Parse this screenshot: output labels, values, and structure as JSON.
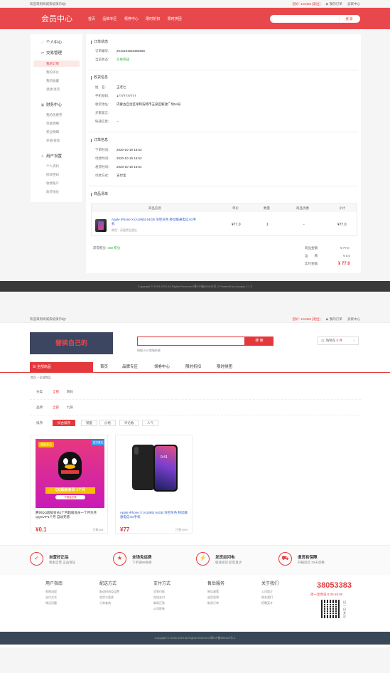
{
  "top": {
    "topbar": {
      "welcome": "欢迎来到商城系统演示站!",
      "user": "您好: 123456 [退出]",
      "my_orders": "★ 我的订单",
      "seller_center": "卖家中心"
    },
    "header": {
      "title": "会员中心",
      "nav": [
        "首页",
        "品牌专区",
        "领券中心",
        "限时折扣",
        "限时拼团"
      ],
      "search_btn": "搜 索"
    },
    "sidebar": {
      "groups": [
        {
          "label": "个人中心",
          "icon": "home-icon"
        },
        {
          "label": "交易管理",
          "icon": "exchange-icon",
          "items": [
            "我的订单",
            "我的评价",
            "我的收藏",
            "退款/退货"
          ]
        },
        {
          "label": "财务中心",
          "icon": "finance-icon",
          "items": [
            "我的优惠券",
            "资金明细",
            "积分明细",
            "充值/提现"
          ]
        },
        {
          "label": "用户设置",
          "icon": "user-icon",
          "items": [
            "个人资料",
            "修改密码",
            "收款账户",
            "收货地址"
          ]
        }
      ]
    },
    "order_status": {
      "title": "订单状态",
      "order_no_label": "订单编号:",
      "order_no": "2010191653355655",
      "status_label": "当前状态:",
      "status": "交易完成"
    },
    "receiver": {
      "title": "收货信息",
      "name_label": "姓　名:",
      "name": "王老七",
      "phone_label": "手机号码:",
      "phone": "17777777777",
      "address_label": "收货地址:",
      "address": "内蒙古自治区呼和浩特市玉泉区解放广场54号",
      "note_label": "买家留言:",
      "note": "",
      "express_label": "快递信息:",
      "express": "--"
    },
    "order_info": {
      "title": "订单信息",
      "rows": [
        {
          "label": "下单时间:",
          "value": "2020-10-19 16:53"
        },
        {
          "label": "付款时间:",
          "value": "2020-10-19 16:53"
        },
        {
          "label": "发货时间:",
          "value": "2020-10-19 16:54"
        },
        {
          "label": "付款方式:",
          "value": "支付宝"
        }
      ]
    },
    "goods": {
      "title": "商品清单",
      "headers": [
        "商品信息",
        "单价",
        "数量",
        "商品优惠",
        "小计"
      ],
      "item": {
        "name": "Apple iPhone X (A1865) 64GB 深空灰色 移动联通电信4G手机",
        "spec": "颜色：深邃黑至遗忘",
        "price": "¥77.0",
        "qty": "1",
        "discount": "-",
        "subtotal": "¥77.0"
      }
    },
    "summary": {
      "points_label": "获得积分:",
      "points": "450 积分",
      "goods_amount_label": "商品金额:",
      "goods_amount": "¥ 77.0",
      "shipping_label": "运　　费:",
      "shipping": "¥ 0.0",
      "paid_label": "实付金额:",
      "paid": "¥ 77.0"
    },
    "footer": "Copyright © 2015-2019 All Rights Reserved 闽ICP备654542号-1   Powered by xiaoyao 1.1.3"
  },
  "bottom": {
    "topbar": {
      "welcome": "欢迎来到商城系统演示站!",
      "user": "您好: 123456 [退出]",
      "my_orders": "★ 我的订单",
      "seller_center": "卖家中心"
    },
    "logo": "替换自己的",
    "search_btn": "搜 索",
    "hot_words": "热搜  B2C商城系统",
    "cart": {
      "label": "购物车",
      "count": "0 件",
      "arrow": "›"
    },
    "all_categories": "☰ 全部商品",
    "nav": [
      "首页",
      "品牌专区",
      "领券中心",
      "限时折扣",
      "限时拼团"
    ],
    "breadcrumb": "首页 > 全部商品",
    "filters": {
      "category_label": "分类:",
      "category_options": [
        "全部",
        "数码"
      ],
      "brand_label": "品牌:",
      "brand_options": [
        "全部",
        "九阳"
      ],
      "sort_label": "排序:",
      "sort_options": [
        "综合排序",
        "销量",
        "价格",
        "评论数",
        "人气"
      ]
    },
    "products": [
      {
        "title": "腾讯QQ超级会员1个月超级会员一个月包月 QQSVIP1个月 自动充值",
        "price": "¥0.1",
        "sold": "已售458",
        "badge": "超级会员",
        "corner": "官方直充",
        "banner": "QQ超级会员·1个月",
        "sub_banner": "不限量兑换"
      },
      {
        "title": "Apple iPhone X (A1865) 64GB 深空灰色 移动联通电信4G手机",
        "price": "¥77",
        "sold": "已售1599",
        "screen_time": "9:41"
      }
    ],
    "features": [
      {
        "icon": "shield-icon",
        "glyph": "✓",
        "title": "自营好正品",
        "desc": "我家自营 正品保证"
      },
      {
        "icon": "medal-icon",
        "glyph": "★",
        "title": "全场免运费",
        "desc": "下单满99免邮"
      },
      {
        "icon": "lightning-icon",
        "glyph": "⚡",
        "title": "发货如闪电",
        "desc": "极速发货 航空直达"
      },
      {
        "icon": "truck-icon",
        "glyph": "⛟",
        "title": "退货有保障",
        "desc": "开箱验货 30天退换"
      }
    ],
    "footer_cols": [
      {
        "title": "用户指南",
        "items": [
          "购物流程",
          "支付方式",
          "常见问题"
        ]
      },
      {
        "title": "配送方式",
        "items": [
          "配送时间及运费",
          "验货与签收",
          "订单查询"
        ]
      },
      {
        "title": "支付方式",
        "items": [
          "货到付款",
          "在线支付",
          "邮局汇款",
          "公司转账"
        ]
      },
      {
        "title": "售后服务",
        "items": [
          "售后政策",
          "退货说明",
          "取消订单"
        ]
      },
      {
        "title": "关于我们",
        "items": [
          "公司简介",
          "联系我们",
          "招聘英才"
        ]
      }
    ],
    "hotline": "38053383",
    "hours": "周一至周日  8:30-18:00",
    "qr_text": "扫一扫关注",
    "footer": "Copyright © 2015-2019 All Rights Reserved 闽ICP备654542号-1"
  },
  "colors": {
    "brand_red": "#e4393c",
    "header_red": "#e8484c",
    "dark_footer": "#3a3a3a",
    "blue_footer": "#384857",
    "success_green": "#2eab3c"
  }
}
